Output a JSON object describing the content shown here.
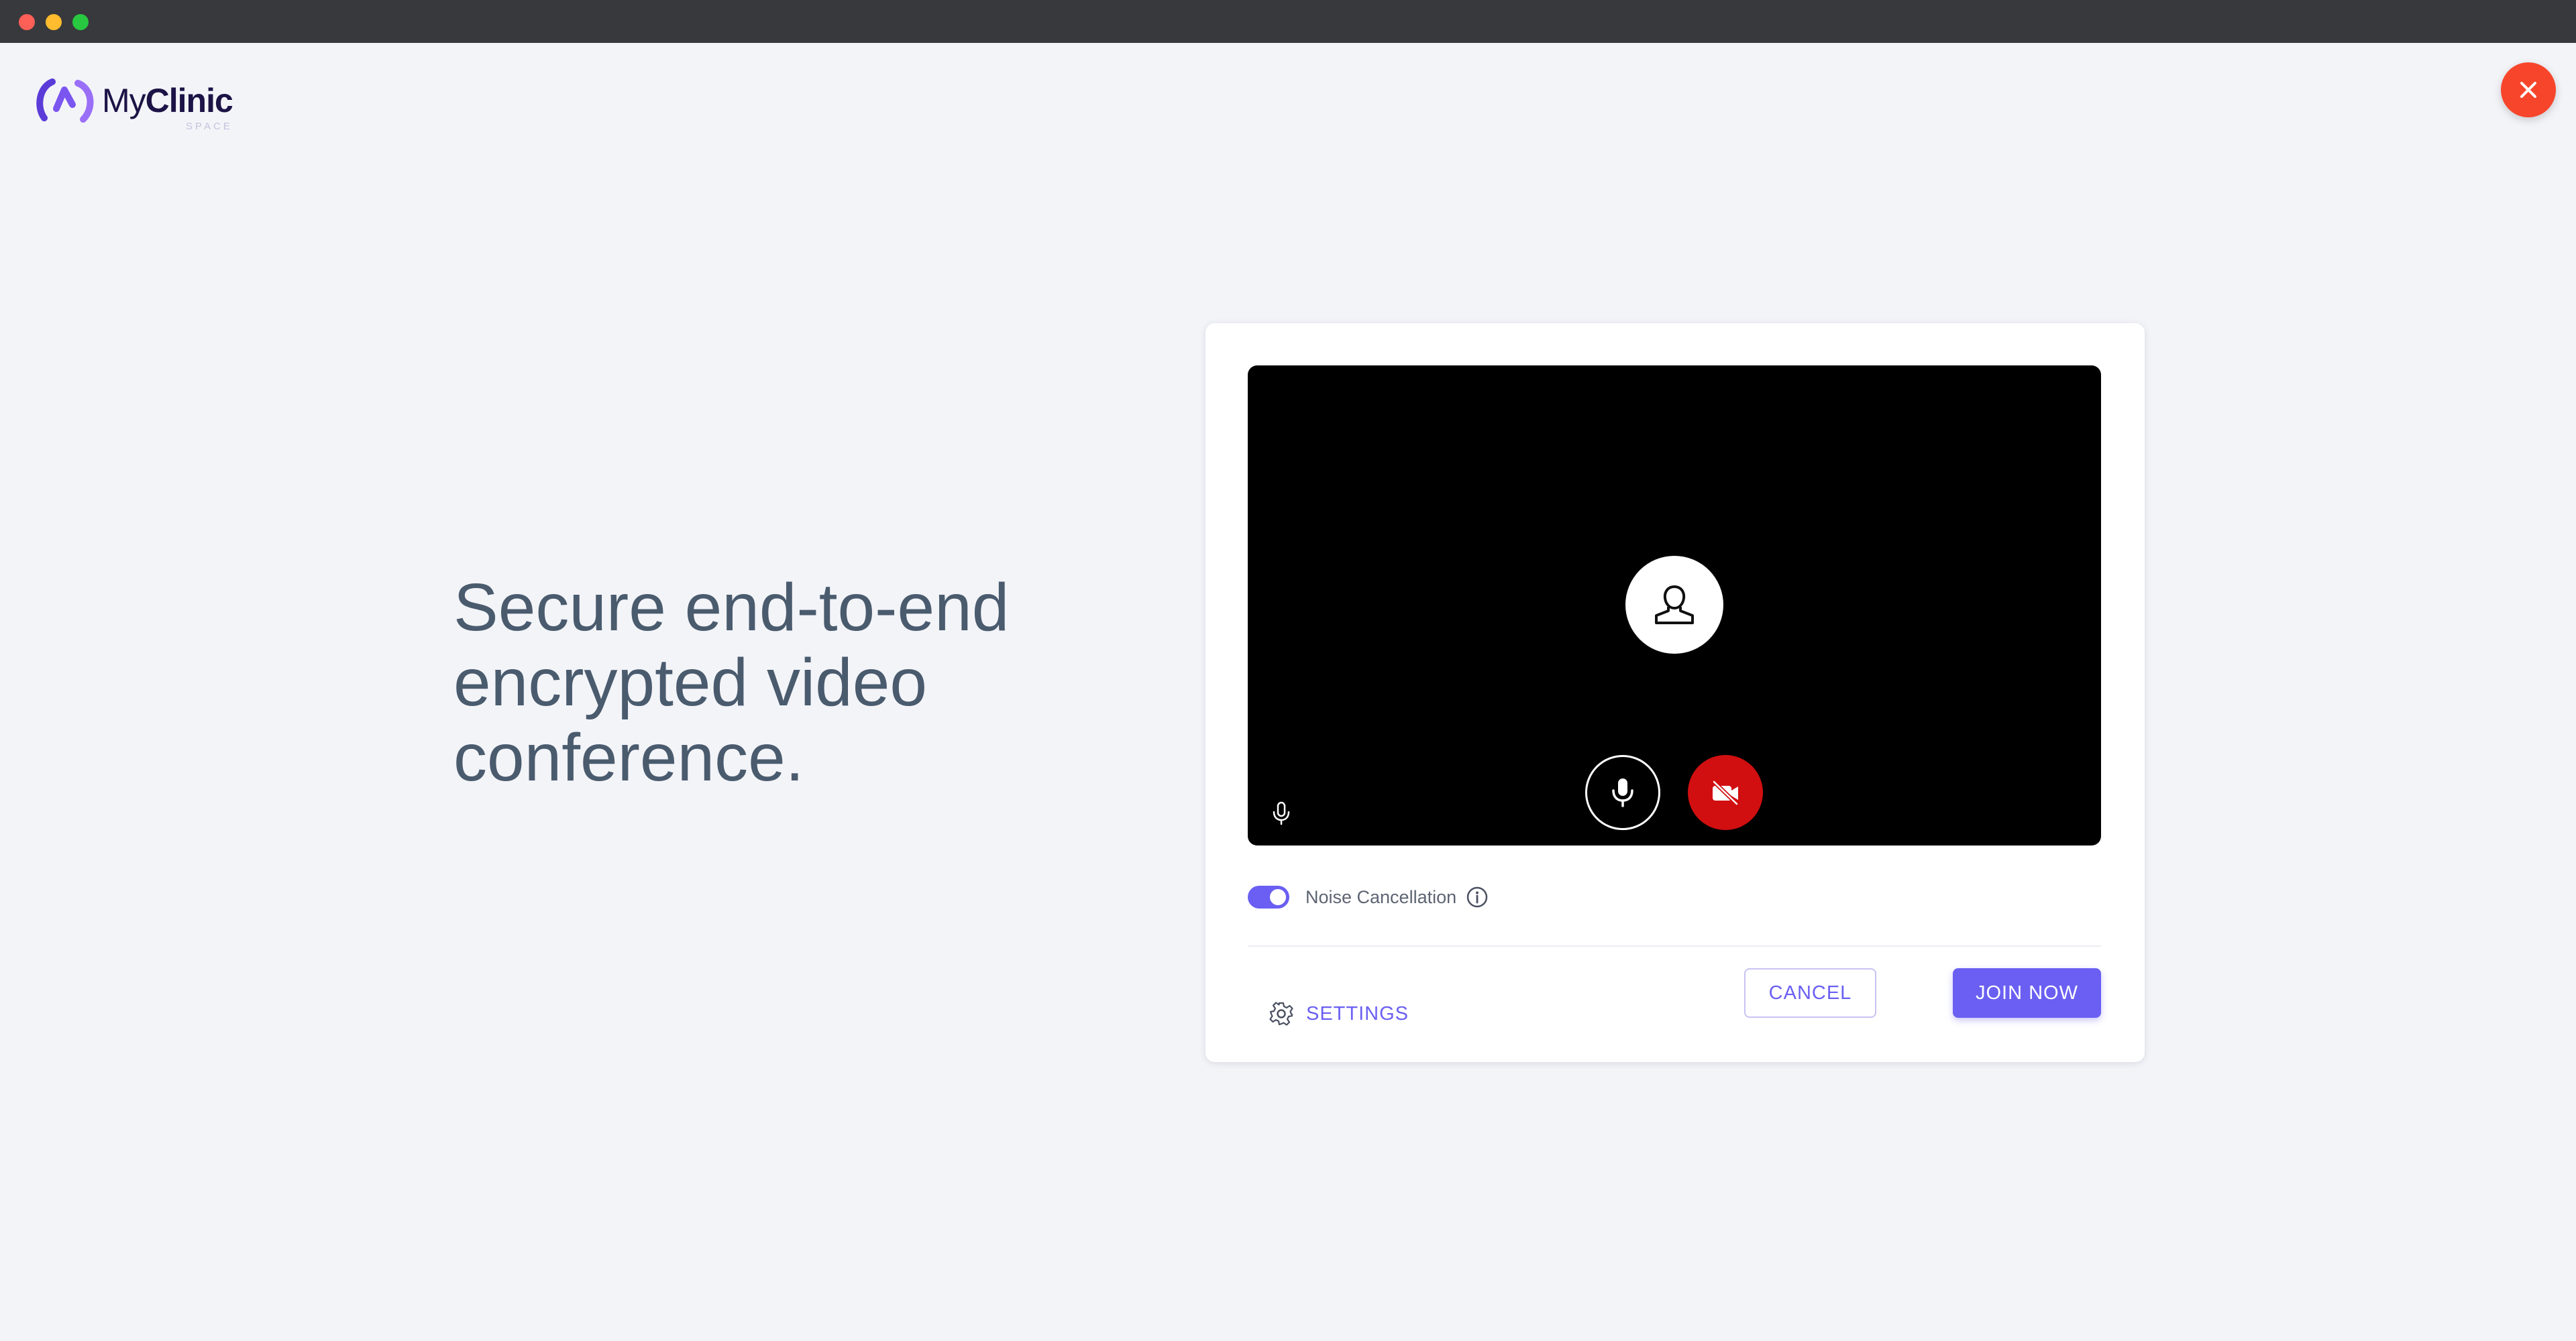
{
  "app": {
    "brand_prefix": "My",
    "brand_name": "Clinic",
    "brand_sub": "SPACE"
  },
  "hero": {
    "line1": "Secure end-to-end",
    "line2": "encrypted video",
    "line3": "conference."
  },
  "preview": {
    "avatar_icon": "user-icon",
    "mic_icon": "microphone-icon",
    "camera_icon": "camera-off-icon",
    "mic_indicator_icon": "microphone-icon"
  },
  "noise": {
    "label": "Noise Cancellation",
    "enabled": true,
    "info_icon": "info-icon"
  },
  "actions": {
    "settings_label": "SETTINGS",
    "settings_icon": "gear-icon",
    "cancel_label": "CANCEL",
    "join_label": "JOIN NOW",
    "close_icon": "close-icon"
  },
  "colors": {
    "accent": "#6a5ff2",
    "close": "#f7452b",
    "camera_off": "#d10f10",
    "headline": "#4a5b6e",
    "background": "#f3f4f8"
  }
}
